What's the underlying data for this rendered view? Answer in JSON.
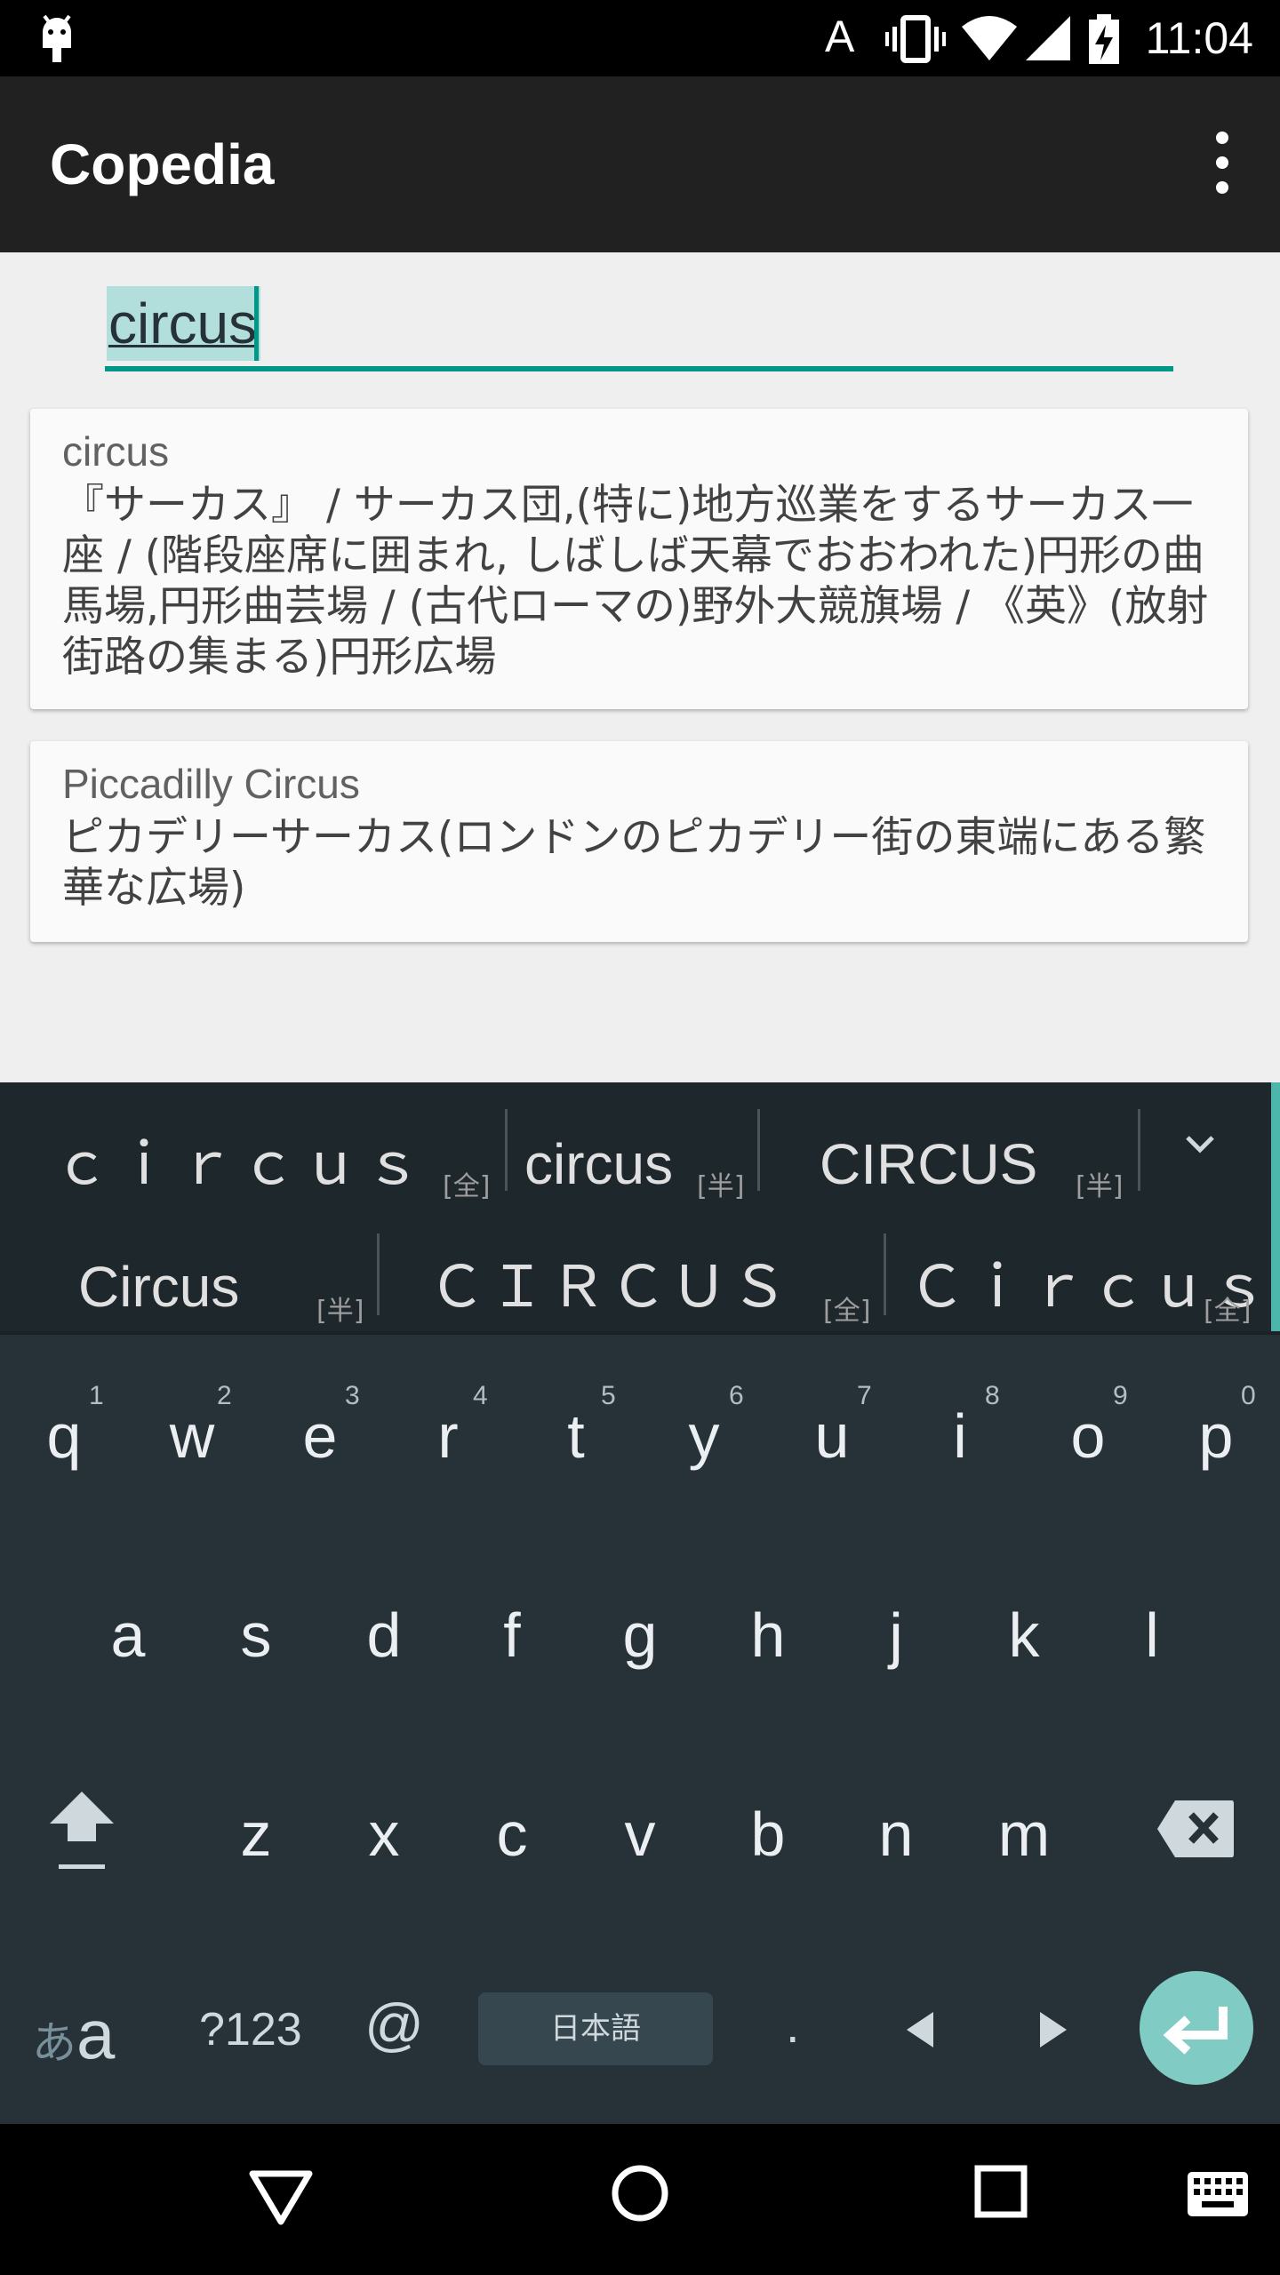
{
  "status_bar": {
    "time": "11:04",
    "icons": [
      "android-debug-icon",
      "keyboard-a-icon",
      "vibrate-icon",
      "wifi-icon",
      "signal-icon",
      "battery-charging-icon"
    ]
  },
  "app_bar": {
    "title": "Copedia",
    "overflow_icon": "more-vert-icon"
  },
  "search": {
    "value": "circus"
  },
  "results": [
    {
      "headword": "circus",
      "definition": "『サーカス』 / サーカス団,(特に)地方巡業をするサーカス一座 / (階段座席に囲まれ, しばしば天幕でおおわれた)円形の曲馬場,円形曲芸場 / (古代ローマの)野外大競旗場 / 《英》(放射街路の集まる)円形広場"
    },
    {
      "headword": "Piccadilly Circus",
      "definition": "ピカデリーサーカス(ロンドンのピカデリー街の東端にある繁華な広場)"
    }
  ],
  "keyboard": {
    "suggestions_row1": [
      {
        "text": "ｃｉｒｃｕｓ",
        "tag": "[全]"
      },
      {
        "text": "circus",
        "tag": "[半]"
      },
      {
        "text": "CIRCUS",
        "tag": "[半]"
      }
    ],
    "suggestions_row2": [
      {
        "text": "Circus",
        "tag": "[半]"
      },
      {
        "text": "ＣＩＲＣＵＳ",
        "tag": "[全]"
      },
      {
        "text": "Ｃｉｒｃｕｓ",
        "tag": "[全]"
      }
    ],
    "row1": [
      "q",
      "w",
      "e",
      "r",
      "t",
      "y",
      "u",
      "i",
      "o",
      "p"
    ],
    "row1_hints": [
      "1",
      "2",
      "3",
      "4",
      "5",
      "6",
      "7",
      "8",
      "9",
      "0"
    ],
    "row2": [
      "a",
      "s",
      "d",
      "f",
      "g",
      "h",
      "j",
      "k",
      "l"
    ],
    "row3": [
      "z",
      "x",
      "c",
      "v",
      "b",
      "n",
      "m"
    ],
    "mode_kana": "あ",
    "mode_latin": "a",
    "symbols": "?123",
    "at": "@",
    "space_label": "日本語",
    "period": ".",
    "accent_color": "#4db6ac",
    "enter_color": "#80cbc4"
  },
  "nav_bar": {
    "icons": [
      "back-icon",
      "home-icon",
      "recents-icon",
      "keyboard-icon"
    ]
  }
}
